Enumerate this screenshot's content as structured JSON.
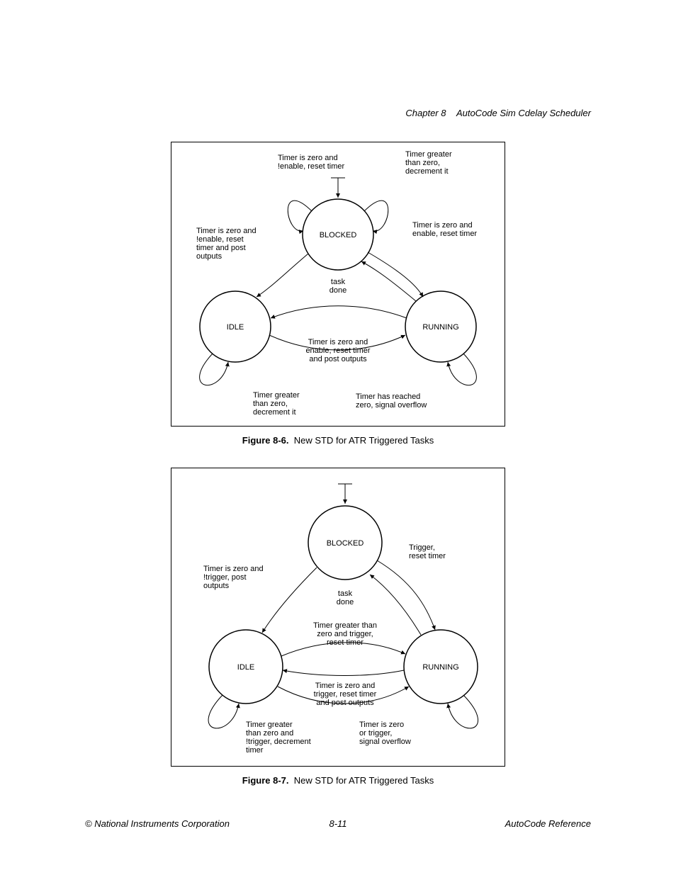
{
  "header": {
    "chapter": "Chapter 8",
    "title": "AutoCode Sim Cdelay Scheduler"
  },
  "footer": {
    "left": "© National Instruments Corporation",
    "center": "8-11",
    "right": "AutoCode Reference"
  },
  "fig1": {
    "caption_num": "Figure 8-6.",
    "caption_text": "New STD for ATR Triggered Tasks",
    "states": {
      "blocked": "BLOCKED",
      "idle": "IDLE",
      "running": "RUNNING"
    },
    "labels": {
      "top_left": "Timer is zero and\n!enable, reset timer",
      "top_right": "Timer greater\nthan zero,\ndecrement it",
      "mid_left": "Timer is zero and\n!enable, reset\ntimer and post\noutputs",
      "mid_right": "Timer is zero and\nenable, reset timer",
      "center": "task\ndone",
      "mid_center": "Timer is zero and\nenable, reset timer\nand post outputs",
      "bot_left": "Timer greater\nthan zero,\ndecrement it",
      "bot_right": "Timer has reached\nzero, signal overflow"
    }
  },
  "fig2": {
    "caption_num": "Figure 8-7.",
    "caption_text": "New STD for ATR Triggered Tasks",
    "states": {
      "blocked": "BLOCKED",
      "idle": "IDLE",
      "running": "RUNNING"
    },
    "labels": {
      "top_right": "Trigger,\nreset timer",
      "mid_left": "Timer is zero and\n!trigger, post\noutputs",
      "center": "task\ndone",
      "upper_mid": "Timer greater than\nzero and trigger,\nreset timer",
      "mid_center": "Timer is zero and\ntrigger, reset timer\nand post outputs",
      "bot_left": "Timer greater\nthan zero and\n!trigger, decrement\ntimer",
      "bot_right": "Timer is zero\nor trigger,\nsignal overflow"
    }
  }
}
